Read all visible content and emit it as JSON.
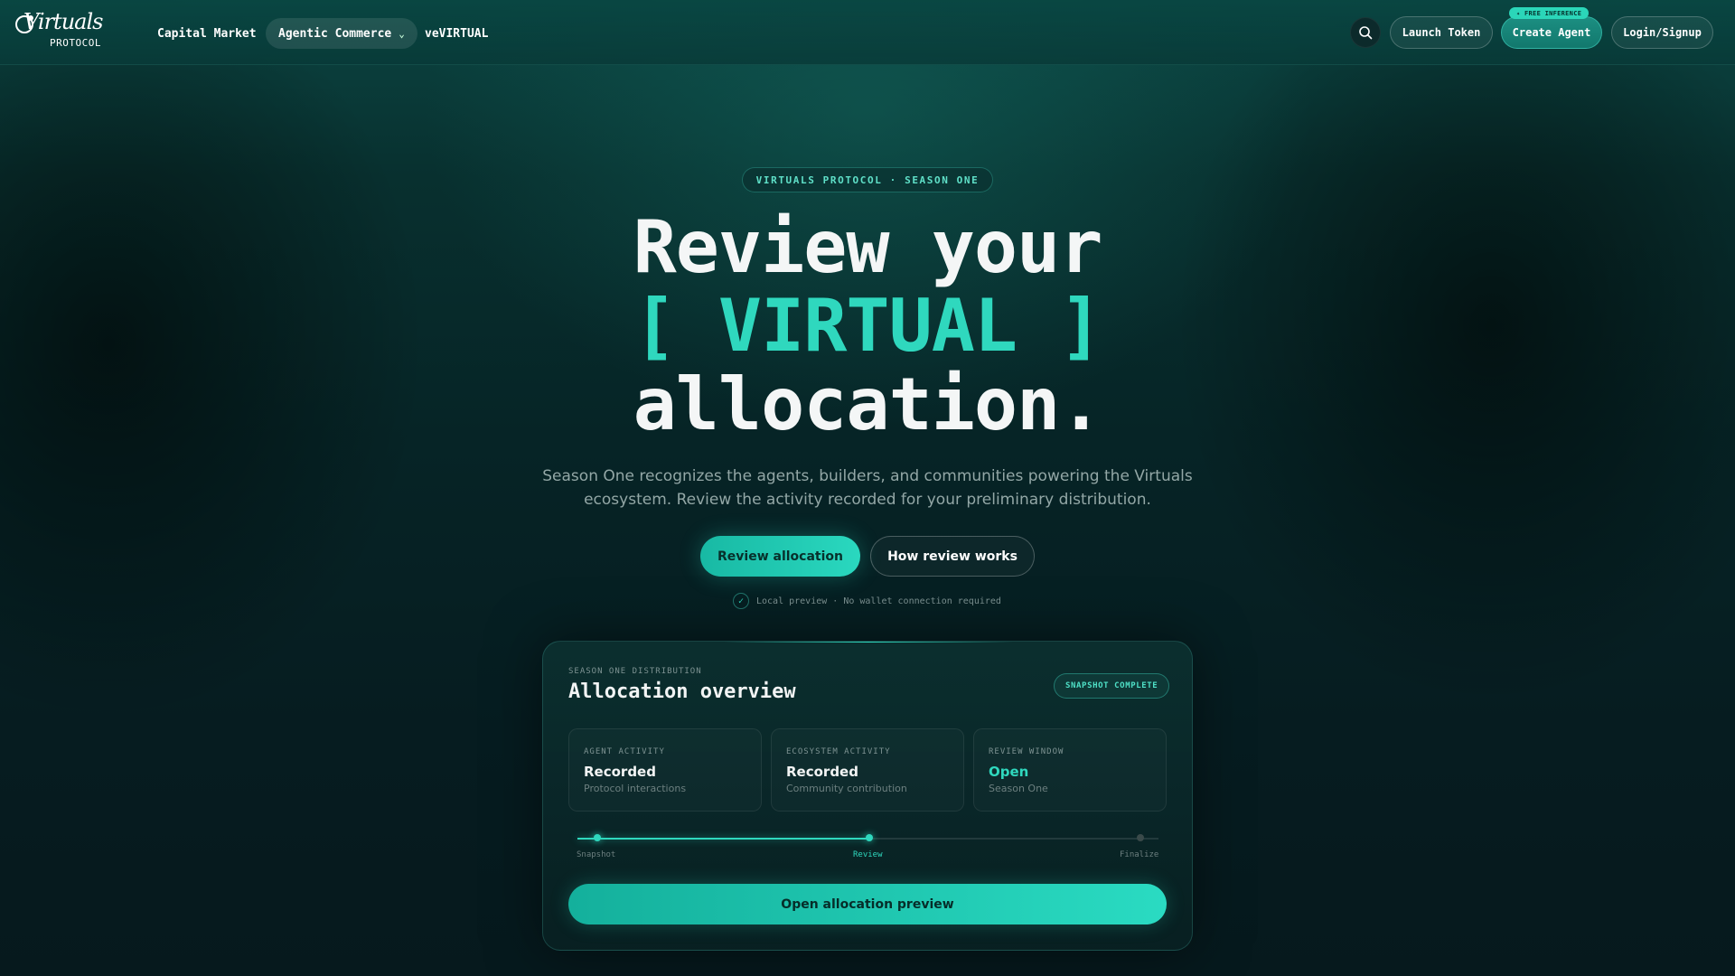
{
  "nav": {
    "logo_script": "Virtuals",
    "logo_sub": "PROTOCOL",
    "links": [
      {
        "label": "Capital Market"
      },
      {
        "label": "Agentic Commerce"
      },
      {
        "label": "veVIRTUAL"
      }
    ],
    "buttons": {
      "launch_token": "Launch Token",
      "create_agent": "Create Agent",
      "login_signup": "Login/Signup",
      "free_badge": "✦ FREE INFERENCE"
    }
  },
  "hero": {
    "eyebrow": "VIRTUALS PROTOCOL · SEASON ONE",
    "headline_line1": "Review your",
    "headline_accent": "[ VIRTUAL ]",
    "headline_line3": "allocation.",
    "lede": "Season One recognizes the agents, builders, and communities powering the Virtuals ecosystem. Review the activity recorded for your preliminary distribution.",
    "primary_cta": "Review allocation",
    "secondary_cta": "How review works",
    "note": "Local preview · No wallet connection required"
  },
  "card": {
    "eyebrow": "SEASON ONE DISTRIBUTION",
    "title": "Allocation overview",
    "badge": "SNAPSHOT COMPLETE",
    "stats": [
      {
        "label": "AGENT ACTIVITY",
        "value": "Recorded",
        "sub": "Protocol interactions"
      },
      {
        "label": "ECOSYSTEM ACTIVITY",
        "value": "Recorded",
        "sub": "Community contribution"
      },
      {
        "label": "REVIEW WINDOW",
        "value": "Open",
        "sub": "Season One"
      }
    ],
    "steps": [
      {
        "label": "Snapshot",
        "state": "done"
      },
      {
        "label": "Review",
        "state": "active"
      },
      {
        "label": "Finalize",
        "state": "pending"
      }
    ],
    "progress": 0.5,
    "open_button": "Open allocation preview"
  },
  "colors": {
    "accent": "#2fd8be",
    "background": "#062426",
    "text_muted": "#93a7a6"
  },
  "icons": [
    "search-icon",
    "chevron-down-icon",
    "check-icon"
  ]
}
